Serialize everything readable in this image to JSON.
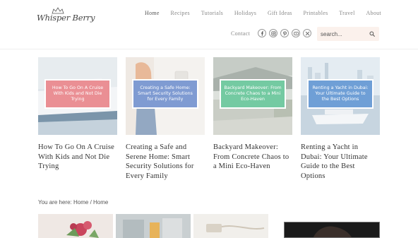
{
  "logo": {
    "text": "Whisper Berry"
  },
  "nav": {
    "items": [
      {
        "label": "Home",
        "active": true
      },
      {
        "label": "Recipes",
        "active": false
      },
      {
        "label": "Tutorials",
        "active": false
      },
      {
        "label": "Holidays",
        "active": false
      },
      {
        "label": "Gift Ideas",
        "active": false
      },
      {
        "label": "Printables",
        "active": false
      },
      {
        "label": "Travel",
        "active": false
      },
      {
        "label": "About",
        "active": false
      }
    ],
    "contact": "Contact"
  },
  "socials": [
    "facebook-icon",
    "instagram-icon",
    "pinterest-icon",
    "youtube-icon",
    "x-icon"
  ],
  "search": {
    "placeholder": "search..."
  },
  "posts": [
    {
      "overlay": "How To Go On A Cruise With Kids and Not Die Trying",
      "title": "How To Go On A Cruise With Kids and Not Die Trying",
      "accent": "#ea8f94"
    },
    {
      "overlay": "Creating a Safe Home: Smart Security Solutions for Every Family",
      "title": "Creating a Safe and Serene Home: Smart Security Solutions for Every Family",
      "accent": "#7f9bd2"
    },
    {
      "overlay": "Backyard Makeover: From Concrete Chaos to a Mini Eco-Haven",
      "title": "Backyard Makeover: From Concrete Chaos to a Mini Eco-Haven",
      "accent": "#74caa2"
    },
    {
      "overlay": "Renting a Yacht in Dubai: Your Ultimate Guide to the Best Options",
      "title": "Renting a Yacht in Dubai: Your Ultimate Guide to the Best Options",
      "accent": "#6f9fd6"
    }
  ],
  "breadcrumb": {
    "prefix": "You are here:",
    "home": "Home",
    "separator": "/",
    "current": "Home"
  }
}
